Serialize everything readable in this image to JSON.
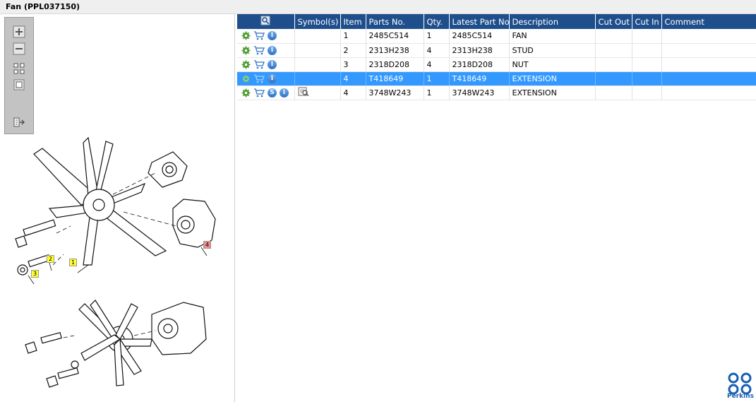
{
  "window": {
    "title": "Fan (PPL037150)"
  },
  "toolbox": {
    "buttons": [
      {
        "name": "zoom-in-button",
        "icon": "zoom-in-icon"
      },
      {
        "name": "zoom-out-button",
        "icon": "zoom-out-icon"
      },
      {
        "name": "fit-all-button",
        "icon": "fit-all-icon"
      },
      {
        "name": "fit-window-button",
        "icon": "fit-window-icon"
      },
      {
        "name": "export-button",
        "icon": "export-icon"
      }
    ]
  },
  "diagram": {
    "callouts": [
      "1",
      "2",
      "3",
      "4"
    ]
  },
  "table": {
    "headers": {
      "actions": "",
      "symbols": "Symbol(s)",
      "item": "Item",
      "parts_no": "Parts No.",
      "qty": "Qty.",
      "latest_part_no": "Latest Part No.",
      "description": "Description",
      "cut_out": "Cut Out",
      "cut_in": "Cut In",
      "comment": "Comment"
    },
    "rows": [
      {
        "item": "1",
        "parts_no": "2485C514",
        "qty": "1",
        "latest_part_no": "2485C514",
        "description": "FAN",
        "cut_out": "",
        "cut_in": "",
        "comment": ""
      },
      {
        "item": "2",
        "parts_no": "2313H238",
        "qty": "4",
        "latest_part_no": "2313H238",
        "description": "STUD",
        "cut_out": "",
        "cut_in": "",
        "comment": ""
      },
      {
        "item": "3",
        "parts_no": "2318D208",
        "qty": "4",
        "latest_part_no": "2318D208",
        "description": "NUT",
        "cut_out": "",
        "cut_in": "",
        "comment": ""
      },
      {
        "item": "4",
        "parts_no": "T418649",
        "qty": "1",
        "latest_part_no": "T418649",
        "description": "EXTENSION",
        "cut_out": "",
        "cut_in": "",
        "comment": ""
      },
      {
        "item": "4",
        "parts_no": "3748W243",
        "qty": "1",
        "latest_part_no": "3748W243",
        "description": "EXTENSION",
        "cut_out": "",
        "cut_in": "",
        "comment": ""
      }
    ],
    "selected_row_index": 3
  },
  "icons": {
    "gear": "gear-icon",
    "cart": "cart-icon",
    "info": "info-icon",
    "info_glyph": "i",
    "supersession": "supersession-icon",
    "supersession_glyph": "S",
    "view_symbol": "view-symbol-icon",
    "header_search": "search-icon"
  },
  "brand": {
    "name": "Perkins",
    "color": "#1a5fb4"
  },
  "colors": {
    "header_bg": "#1f4e8c",
    "selected_bg": "#3399ff",
    "gear": "#4a9a2a"
  }
}
